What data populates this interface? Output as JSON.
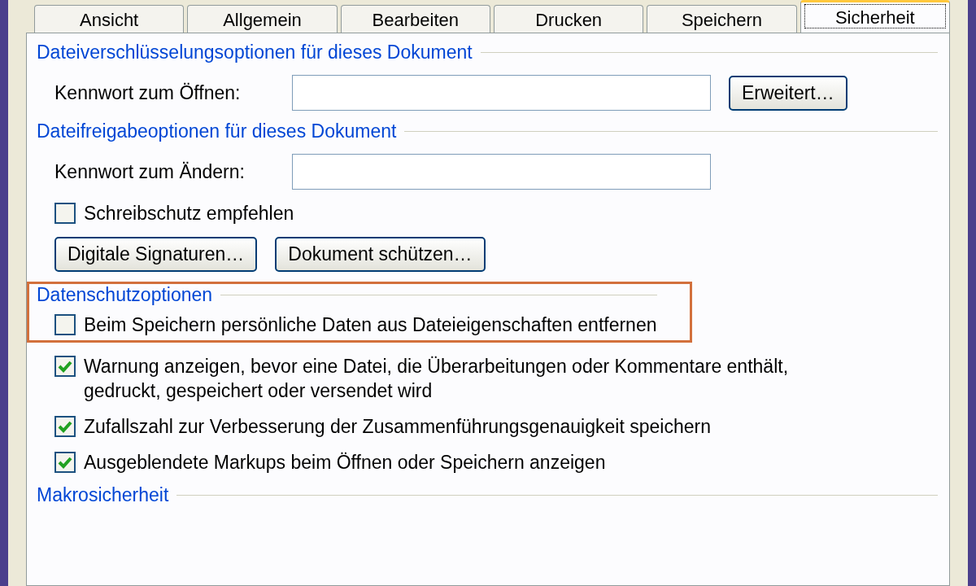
{
  "tabs": [
    {
      "label": "Ansicht",
      "selected": false
    },
    {
      "label": "Allgemein",
      "selected": false
    },
    {
      "label": "Bearbeiten",
      "selected": false
    },
    {
      "label": "Drucken",
      "selected": false
    },
    {
      "label": "Speichern",
      "selected": false
    },
    {
      "label": "Sicherheit",
      "selected": true
    }
  ],
  "sections": [
    {
      "title": "Dateiverschlüsselungsoptionen für dieses Dokument",
      "items": [
        {
          "kind": "password",
          "label": "Kennwort zum Öffnen:",
          "button": "Erweitert…"
        }
      ]
    },
    {
      "title": "Dateifreigabeoptionen für dieses Dokument",
      "items": [
        {
          "kind": "password",
          "label": "Kennwort zum Ändern:"
        },
        {
          "kind": "checkbox",
          "label": "Schreibschutz empfehlen",
          "checked": false
        },
        {
          "kind": "buttons",
          "buttons": [
            "Digitale Signaturen…",
            "Dokument schützen…"
          ]
        }
      ]
    },
    {
      "title": "Datenschutzoptionen",
      "highlight_box": {
        "items": [
          {
            "kind": "checkbox",
            "label": "Beim Speichern persönliche Daten aus Dateieigenschaften entfernen",
            "checked": false
          }
        ]
      },
      "items": [
        {
          "kind": "checkbox",
          "label": "Warnung anzeigen, bevor eine Datei, die Überarbeitungen oder Kommentare enthält, gedruckt, gespeichert oder versendet wird",
          "checked": true
        },
        {
          "kind": "checkbox",
          "label": "Zufallszahl zur Verbesserung der Zusammenführungsgenauigkeit speichern",
          "checked": true
        },
        {
          "kind": "checkbox",
          "label": "Ausgeblendete Markups beim Öffnen oder Speichern anzeigen",
          "checked": true
        }
      ]
    },
    {
      "title": "Makrosicherheit"
    }
  ]
}
